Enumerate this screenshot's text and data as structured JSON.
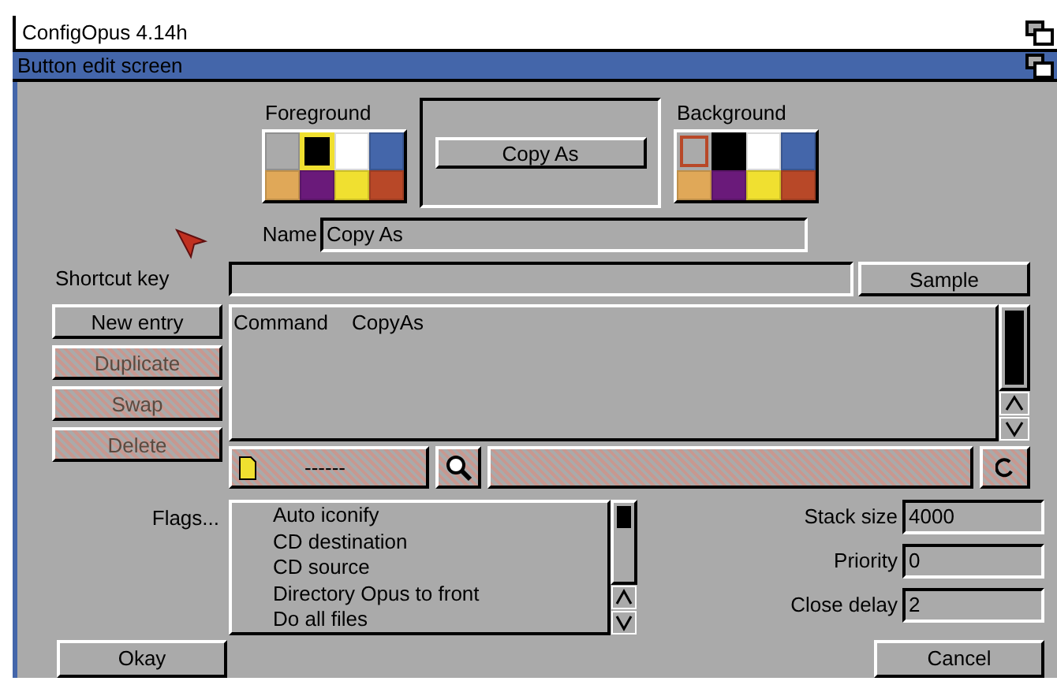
{
  "screen": {
    "title": "ConfigOpus 4.14h"
  },
  "window": {
    "title": "Button edit screen"
  },
  "foreground": {
    "label": "Foreground",
    "swatches": [
      {
        "color": "#aaaaaa",
        "selected": false
      },
      {
        "color": "#000000",
        "selected": true
      },
      {
        "color": "#ffffff",
        "selected": false
      },
      {
        "color": "#4466aa",
        "selected": false
      },
      {
        "color": "#e0a858",
        "selected": false
      },
      {
        "color": "#6a1a7a",
        "selected": false
      },
      {
        "color": "#f0e030",
        "selected": false
      },
      {
        "color": "#b84828",
        "selected": false
      }
    ]
  },
  "preview_button": {
    "label": "Copy As"
  },
  "background": {
    "label": "Background",
    "swatches": [
      {
        "color": "#aaaaaa",
        "selected": true
      },
      {
        "color": "#000000",
        "selected": false
      },
      {
        "color": "#ffffff",
        "selected": false
      },
      {
        "color": "#4466aa",
        "selected": false
      },
      {
        "color": "#e0a858",
        "selected": false
      },
      {
        "color": "#6a1a7a",
        "selected": false
      },
      {
        "color": "#f0e030",
        "selected": false
      },
      {
        "color": "#b84828",
        "selected": false
      }
    ]
  },
  "name_field": {
    "label": "Name",
    "value": "Copy As"
  },
  "shortcut_field": {
    "label": "Shortcut key"
  },
  "sample_button": {
    "label": "Sample"
  },
  "entry_buttons": [
    {
      "label": "New entry",
      "disabled": false
    },
    {
      "label": "Duplicate",
      "disabled": true
    },
    {
      "label": "Swap",
      "disabled": true
    },
    {
      "label": "Delete",
      "disabled": true
    }
  ],
  "commands": [
    {
      "type": "Command",
      "instruction": "CopyAs"
    }
  ],
  "function_bar": {
    "type_button": {
      "label": "------",
      "disabled": true
    },
    "find_button": {
      "disabled": true
    },
    "argument_field": {
      "disabled": true
    },
    "edit_button": {
      "disabled": true
    }
  },
  "flags": {
    "label": "Flags...",
    "items": [
      "Auto iconify",
      "CD destination",
      "CD source",
      "Directory Opus to front",
      "Do all files"
    ]
  },
  "settings": [
    {
      "label": "Stack size",
      "value": "4000"
    },
    {
      "label": "Priority",
      "value": "0"
    },
    {
      "label": "Close delay",
      "value": "2"
    }
  ],
  "buttons": [
    {
      "label": "Okay"
    },
    {
      "label": "Cancel"
    }
  ]
}
